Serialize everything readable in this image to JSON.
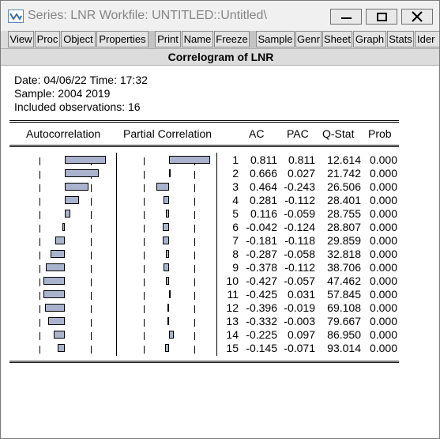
{
  "window": {
    "title": "Series: LNR   Workfile: UNTITLED::Untitled\\",
    "controls": [
      "minimize",
      "maximize",
      "close"
    ]
  },
  "toolbar": {
    "buttons": [
      "View",
      "Proc",
      "Object",
      "Properties",
      "Print",
      "Name",
      "Freeze",
      "Sample",
      "Genr",
      "Sheet",
      "Graph",
      "Stats",
      "Ider"
    ]
  },
  "view_title": "Correlogram of LNR",
  "info": {
    "date_line": "Date: 04/06/22   Time: 17:32",
    "sample_line": "Sample: 2004 2019",
    "obs_line": "Included observations: 16"
  },
  "columns": {
    "autocorrelation": "Autocorrelation",
    "partial": "Partial Correlation",
    "ac": "AC",
    "pac": "PAC",
    "qstat": "Q-Stat",
    "prob": "Prob"
  },
  "colors": {
    "bar_fill": "#a9b3cd",
    "background": "#ffffff"
  },
  "rows": [
    {
      "lag": "1",
      "ac": "0.811",
      "pac": "0.811",
      "q": "12.614",
      "prob": "0.000"
    },
    {
      "lag": "2",
      "ac": "0.666",
      "pac": "0.027",
      "q": "21.742",
      "prob": "0.000"
    },
    {
      "lag": "3",
      "ac": "0.464",
      "pac": "-0.243",
      "q": "26.506",
      "prob": "0.000"
    },
    {
      "lag": "4",
      "ac": "0.281",
      "pac": "-0.112",
      "q": "28.401",
      "prob": "0.000"
    },
    {
      "lag": "5",
      "ac": "0.116",
      "pac": "-0.059",
      "q": "28.755",
      "prob": "0.000"
    },
    {
      "lag": "6",
      "ac": "-0.042",
      "pac": "-0.124",
      "q": "28.807",
      "prob": "0.000"
    },
    {
      "lag": "7",
      "ac": "-0.181",
      "pac": "-0.118",
      "q": "29.859",
      "prob": "0.000"
    },
    {
      "lag": "8",
      "ac": "-0.287",
      "pac": "-0.058",
      "q": "32.818",
      "prob": "0.000"
    },
    {
      "lag": "9",
      "ac": "-0.378",
      "pac": "-0.112",
      "q": "38.706",
      "prob": "0.000"
    },
    {
      "lag": "10",
      "ac": "-0.427",
      "pac": "-0.057",
      "q": "47.462",
      "prob": "0.000"
    },
    {
      "lag": "11",
      "ac": "-0.425",
      "pac": "0.031",
      "q": "57.845",
      "prob": "0.000"
    },
    {
      "lag": "12",
      "ac": "-0.396",
      "pac": "-0.019",
      "q": "69.108",
      "prob": "0.000"
    },
    {
      "lag": "13",
      "ac": "-0.332",
      "pac": "-0.003",
      "q": "79.667",
      "prob": "0.000"
    },
    {
      "lag": "14",
      "ac": "-0.225",
      "pac": "0.097",
      "q": "86.950",
      "prob": "0.000"
    },
    {
      "lag": "15",
      "ac": "-0.145",
      "pac": "-0.071",
      "q": "93.014",
      "prob": "0.000"
    }
  ]
}
